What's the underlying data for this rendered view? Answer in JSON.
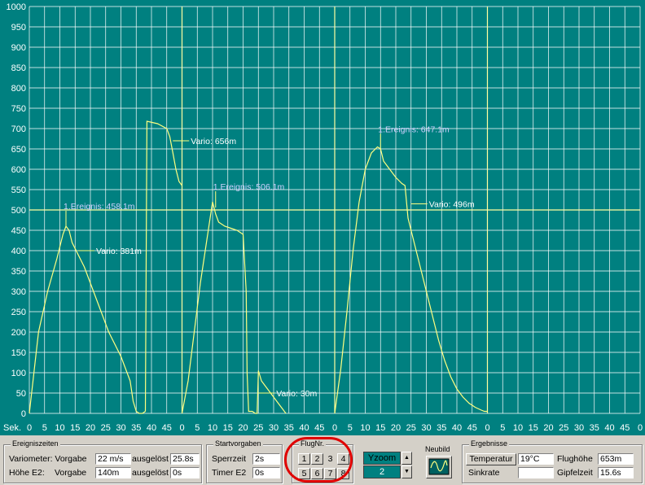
{
  "chart_data": {
    "type": "line",
    "xlabel": "Sek.",
    "ylim": [
      0,
      1000
    ],
    "yticks": [
      0,
      50,
      100,
      150,
      200,
      250,
      300,
      350,
      400,
      450,
      500,
      550,
      600,
      650,
      700,
      750,
      800,
      850,
      900,
      950,
      1000
    ],
    "xtick_labels": [
      "0",
      "5",
      "10",
      "15",
      "20",
      "25",
      "30",
      "35",
      "40",
      "45",
      "0",
      "5",
      "10",
      "15",
      "20",
      "25",
      "30",
      "35",
      "40",
      "45",
      "0",
      "5",
      "10",
      "15",
      "20",
      "25",
      "30",
      "35",
      "40",
      "45",
      "0",
      "5",
      "10",
      "15",
      "20",
      "25",
      "30",
      "35",
      "40",
      "45",
      "0"
    ],
    "grid": true,
    "colors": {
      "background": "#008080",
      "line": "#ffff80",
      "grid": "#ffffff",
      "label": "#ffffff"
    },
    "series": [
      {
        "x": [
          0,
          3,
          6,
          9,
          11,
          12,
          13,
          14,
          16,
          18,
          22,
          26,
          30,
          33,
          34,
          35,
          36,
          37,
          38
        ],
        "y": [
          0,
          200,
          300,
          380,
          440,
          460,
          450,
          420,
          390,
          360,
          280,
          200,
          140,
          80,
          30,
          5,
          0,
          0,
          5
        ]
      },
      {
        "x": [
          38,
          38.5,
          42,
          45,
          46,
          47,
          48,
          49,
          50
        ],
        "y": [
          5,
          718,
          712,
          700,
          680,
          640,
          600,
          570,
          560
        ]
      },
      {
        "x": [
          50,
          52,
          54,
          56,
          58,
          60,
          61,
          62,
          63,
          64,
          66,
          68,
          70,
          71,
          71.3,
          71.8,
          73,
          74,
          74.6,
          75,
          76,
          78,
          80,
          82,
          83,
          84
        ],
        "y": [
          0,
          80,
          200,
          320,
          420,
          520,
          490,
          470,
          465,
          460,
          455,
          450,
          440,
          300,
          100,
          5,
          5,
          0,
          0,
          105,
          80,
          60,
          40,
          20,
          10,
          0
        ]
      },
      {
        "x": [
          100,
          102,
          104,
          106,
          108,
          110,
          112,
          114,
          115,
          116,
          118,
          120,
          122,
          123,
          124,
          126,
          128,
          130,
          132,
          134,
          136,
          138,
          140,
          142,
          144,
          146,
          148,
          149,
          150
        ],
        "y": [
          0,
          110,
          250,
          400,
          520,
          600,
          640,
          655,
          650,
          620,
          600,
          580,
          565,
          560,
          480,
          420,
          360,
          300,
          240,
          180,
          130,
          90,
          60,
          40,
          25,
          15,
          8,
          5,
          5
        ]
      }
    ],
    "annotations": [
      {
        "text": "1.Ereignis: 458.1m",
        "x": 12,
        "y": 458,
        "type": "event"
      },
      {
        "text": "Vario: 381m",
        "x": 16,
        "y": 400,
        "type": "vario"
      },
      {
        "text": "Vario: 656m",
        "x": 47,
        "y": 670,
        "type": "vario"
      },
      {
        "text": "1.Ereignis: 506.1m",
        "x": 61,
        "y": 506,
        "type": "event"
      },
      {
        "text": "Vario: 30m",
        "x": 75,
        "y": 50,
        "type": "vario"
      },
      {
        "text": "1.Ereignis: 647.1m",
        "x": 115,
        "y": 647,
        "type": "event"
      },
      {
        "text": "Vario: 496m",
        "x": 125,
        "y": 515,
        "type": "vario"
      }
    ]
  },
  "ereigniszeiten": {
    "title": "Ereigniszeiten",
    "row1": {
      "label": "Variometer: Vorgabe",
      "vorgabe": "22 m/s",
      "ausgeloest_label": "ausgelöst",
      "ausgeloest": "25.8s"
    },
    "row2": {
      "label": "Höhe E2:",
      "vorgabe_label": "Vorgabe",
      "vorgabe": "140m",
      "ausgeloest_label": "ausgelöst",
      "ausgeloest": "0s"
    }
  },
  "startvorgaben": {
    "title": "Startvorgaben",
    "sperrzeit_label": "Sperrzeit",
    "sperrzeit": "2s",
    "timer_label": "Timer E2",
    "timer": "0s"
  },
  "flugnr": {
    "title": "FlugNr.",
    "buttons": [
      "1",
      "2",
      "3",
      "4",
      "5",
      "6",
      "7",
      "8"
    ],
    "selected": "3"
  },
  "yzoom": {
    "label": "Yzoom",
    "value": "2",
    "up": "▲",
    "down": "▼"
  },
  "neubild": {
    "title": "Neubild"
  },
  "ergebnisse": {
    "title": "Ergebnisse",
    "temperatur_label": "Temperatur",
    "temperatur": "19°C",
    "sinkrate_label": "Sinkrate",
    "sinkrate": "",
    "flughoehe_label": "Flughöhe",
    "flughoehe": "653m",
    "gipfelzeit_label": "Gipfelzeit",
    "gipfelzeit": "15.6s"
  }
}
